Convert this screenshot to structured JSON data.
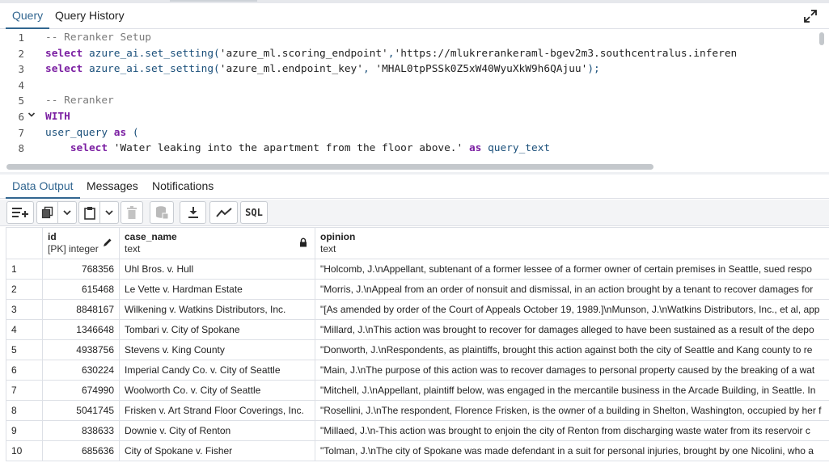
{
  "query_tabs": [
    {
      "label": "Query",
      "active": true
    },
    {
      "label": "Query History",
      "active": false
    }
  ],
  "editor": {
    "line_numbers": [
      "1",
      "2",
      "3",
      "4",
      "5",
      "6",
      "7",
      "8"
    ],
    "lines": [
      [
        {
          "t": "cm",
          "v": "-- Reranker Setup"
        }
      ],
      [
        {
          "t": "kw",
          "v": "select"
        },
        {
          "t": "fn",
          "v": " azure_ai.set_setting("
        },
        {
          "t": "str",
          "v": "'azure_ml.scoring_endpoint'"
        },
        {
          "t": "fn",
          "v": ","
        },
        {
          "t": "str",
          "v": "'https://mlukrerankeraml-bgev2m3.southcentralus.inferen"
        }
      ],
      [
        {
          "t": "kw",
          "v": "select"
        },
        {
          "t": "fn",
          "v": " azure_ai.set_setting("
        },
        {
          "t": "str",
          "v": "'azure_ml.endpoint_key'"
        },
        {
          "t": "fn",
          "v": ", "
        },
        {
          "t": "str",
          "v": "'MHAL0tpPSSk0Z5xW40WyuXkW9h6QAjuu'"
        },
        {
          "t": "fn",
          "v": ");"
        }
      ],
      [],
      [
        {
          "t": "cm",
          "v": "-- Reranker"
        }
      ],
      [
        {
          "t": "kw",
          "v": "WITH"
        }
      ],
      [
        {
          "t": "fn",
          "v": "user_query "
        },
        {
          "t": "kw",
          "v": "as"
        },
        {
          "t": "fn",
          "v": " ("
        }
      ],
      [
        {
          "t": "fn",
          "v": "    "
        },
        {
          "t": "kw",
          "v": "select"
        },
        {
          "t": "str",
          "v": " 'Water leaking into the apartment from the floor above.'"
        },
        {
          "t": "fn",
          "v": " "
        },
        {
          "t": "kw",
          "v": "as"
        },
        {
          "t": "fn",
          "v": " query_text"
        }
      ]
    ]
  },
  "result_tabs": [
    {
      "label": "Data Output",
      "active": true
    },
    {
      "label": "Messages",
      "active": false
    },
    {
      "label": "Notifications",
      "active": false
    }
  ],
  "toolbar": {
    "sql_label": "SQL"
  },
  "grid": {
    "columns": [
      {
        "name": "id",
        "type": "[PK] integer",
        "icon": "pencil-icon"
      },
      {
        "name": "case_name",
        "type": "text",
        "icon": "lock-icon"
      },
      {
        "name": "opinion",
        "type": "text",
        "icon": ""
      }
    ],
    "rows": [
      [
        "1",
        "768356",
        "Uhl Bros. v. Hull",
        "\"Holcomb, J.\\nAppellant, subtenant of a former lessee of a former owner of certain premises in Seattle, sued respo"
      ],
      [
        "2",
        "615468",
        "Le Vette v. Hardman Estate",
        "\"Morris, J.\\nAppeal from an order of nonsuit and dismissal, in an action brought by a tenant to recover damages for"
      ],
      [
        "3",
        "8848167",
        "Wilkening v. Watkins Distributors, Inc.",
        "\"[As amended by order of the Court of Appeals October 19, 1989.]\\nMunson, J.\\nWatkins Distributors, Inc., et al, app"
      ],
      [
        "4",
        "1346648",
        "Tombari v. City of Spokane",
        "\"Millard, J.\\nThis action was brought to recover for damages alleged to have been sustained as a result of the depo"
      ],
      [
        "5",
        "4938756",
        "Stevens v. King County",
        "\"Donworth, J.\\nRespondents, as plaintiffs, brought this action against both the city of Seattle and Kang county to re"
      ],
      [
        "6",
        "630224",
        "Imperial Candy Co. v. City of Seattle",
        "\"Main, J.\\nThe purpose of this action was to recover damages to personal property caused by the breaking of a wat"
      ],
      [
        "7",
        "674990",
        "Woolworth Co. v. City of Seattle",
        "\"Mitchell, J.\\nAppellant, plaintiff below, was engaged in the mercantile business in the Arcade Building, in Seattle. In"
      ],
      [
        "8",
        "5041745",
        "Frisken v. Art Strand Floor Coverings, Inc.",
        "\"Rosellini, J.\\nThe respondent, Florence Frisken, is the owner of a building in Shelton, Washington, occupied by her f"
      ],
      [
        "9",
        "838633",
        "Downie v. City of Renton",
        "\"Millaed, J.\\n-This action was brought to enjoin the city of Renton from discharging waste water from its reservoir c"
      ],
      [
        "10",
        "685636",
        "City of Spokane v. Fisher",
        "\"Tolman, J.\\nThe city of Spokane was made defendant in a suit for personal injuries, brought by one Nicolini, who a"
      ]
    ]
  }
}
